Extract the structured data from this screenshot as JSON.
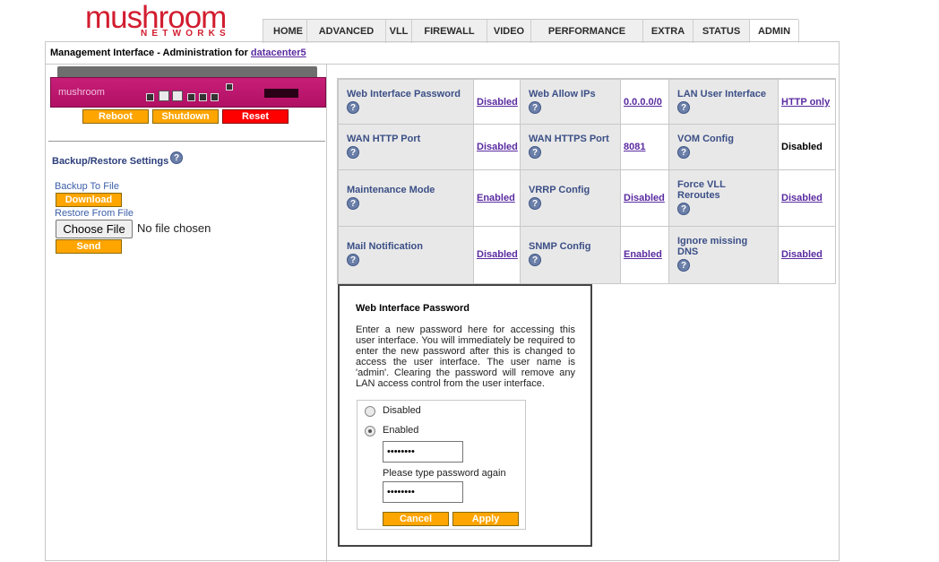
{
  "logo": {
    "main": "mushroom",
    "sub": "NETWORKS"
  },
  "nav": {
    "tabs": [
      {
        "label": "HOME"
      },
      {
        "label": "ADVANCED"
      },
      {
        "label": "VLL"
      },
      {
        "label": "FIREWALL"
      },
      {
        "label": "VIDEO"
      },
      {
        "label": "PERFORMANCE"
      },
      {
        "label": "EXTRA"
      },
      {
        "label": "STATUS"
      },
      {
        "label": "ADMIN"
      }
    ],
    "active": "ADMIN"
  },
  "header": {
    "title_prefix": "Management Interface - Administration for ",
    "device_link": "datacenter5"
  },
  "device": {
    "brand": "mushroom",
    "buttons": {
      "reboot": "Reboot",
      "shutdown": "Shutdown",
      "reset": "Reset"
    }
  },
  "backup": {
    "title": "Backup/Restore Settings",
    "backup_label": "Backup To File",
    "download": "Download",
    "restore_label": "Restore From File",
    "choose_file": "Choose File",
    "no_file": "No file chosen",
    "send": "Send"
  },
  "settings": {
    "rows": [
      [
        {
          "label": "Web Interface Password",
          "value": "Disabled",
          "link": true
        },
        {
          "label": "Web Allow IPs",
          "value": "0.0.0.0/0",
          "link": true
        },
        {
          "label": "LAN User Interface",
          "value": "HTTP only",
          "link": true
        }
      ],
      [
        {
          "label": "WAN HTTP Port",
          "value": "Disabled",
          "link": true
        },
        {
          "label": "WAN HTTPS Port",
          "value": "8081",
          "link": true
        },
        {
          "label": "VOM Config",
          "value": "Disabled",
          "link": false
        }
      ],
      [
        {
          "label": "Maintenance Mode",
          "value": "Enabled",
          "link": true
        },
        {
          "label": "VRRP Config",
          "value": "Disabled",
          "link": true
        },
        {
          "label": "Force VLL Reroutes",
          "value": "Disabled",
          "link": true
        }
      ],
      [
        {
          "label": "Mail Notification",
          "value": "Disabled",
          "link": true
        },
        {
          "label": "SNMP Config",
          "value": "Enabled",
          "link": true
        },
        {
          "label": "Ignore missing DNS",
          "value": "Disabled",
          "link": true
        }
      ]
    ]
  },
  "popup": {
    "title": "Web Interface Password",
    "description": "Enter a new password here for accessing this user interface. You will immediately be required to enter the new password after this is changed to access the user interface. The user name is 'admin'. Clearing the password will remove any LAN access control from the user interface.",
    "options": {
      "disabled": "Disabled",
      "enabled": "Enabled"
    },
    "selected": "Enabled",
    "password_value": "••••••••",
    "again_label": "Please type password again",
    "password_again_value": "••••••••",
    "cancel": "Cancel",
    "apply": "Apply"
  },
  "help_icon_glyph": "?",
  "colors": {
    "brand_red": "#d21d2f",
    "button_orange": "#ffa500",
    "reset_red": "#ff0000",
    "device_magenta": "#c81e78",
    "label_blue": "#3b4f86",
    "link_purple": "#5a2ba0"
  }
}
